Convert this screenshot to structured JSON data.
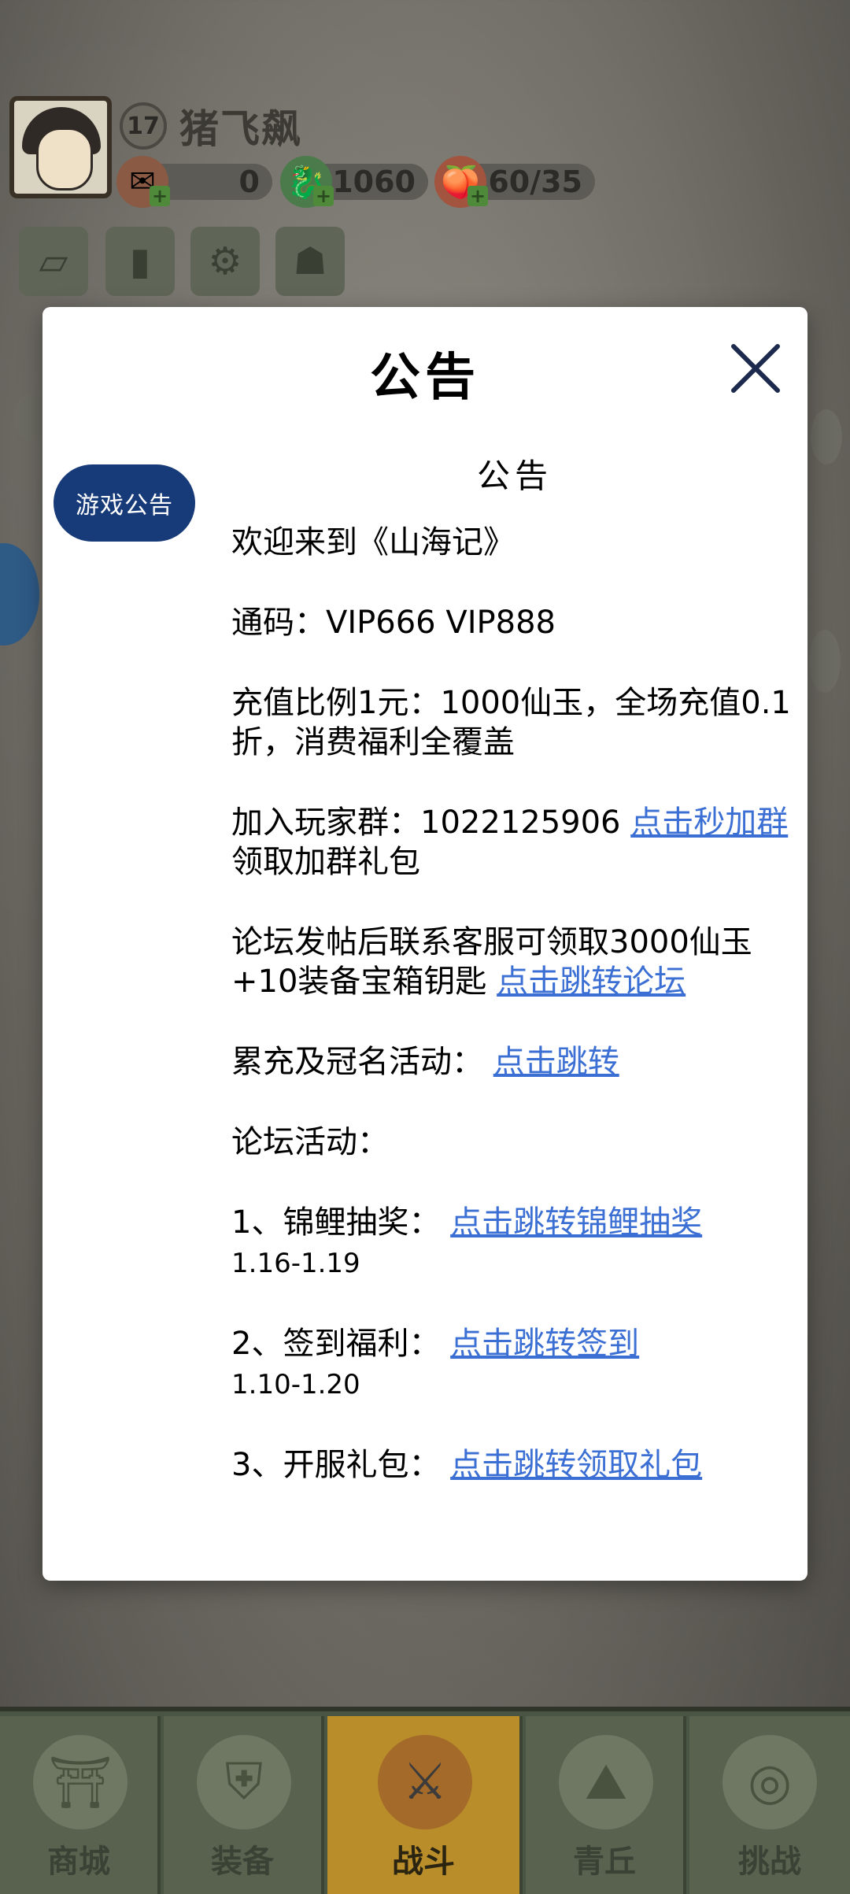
{
  "player": {
    "level": "17",
    "name": "猪飞飙",
    "resources": [
      {
        "icon": "red-packet-icon",
        "value": "0"
      },
      {
        "icon": "dragon-icon",
        "value": "1060"
      },
      {
        "icon": "peach-icon",
        "value": "160/35"
      }
    ]
  },
  "function_buttons": [
    "card-icon",
    "rank-chart-icon",
    "settings-gear-icon",
    "friends-icon"
  ],
  "modal": {
    "title": "公告",
    "tab_label": "游戏公告",
    "content": {
      "subtitle": "公告",
      "welcome": "欢迎来到《山海记》",
      "codes": "通码：VIP666 VIP888",
      "recharge": "充值比例1元：1000仙玉，全场充值0.1折，消费福利全覆盖",
      "group_prefix": "加入玩家群：1022125906 ",
      "group_link": "点击秒加群",
      "group_suffix": "领取加群礼包",
      "forum_prefix": "论坛发帖后联系客服可领取3000仙玉+10装备宝箱钥匙 ",
      "forum_link": "点击跳转论坛",
      "cumulative_prefix": "累充及冠名活动：  ",
      "cumulative_link": "点击跳转",
      "forum_activity": "论坛活动：",
      "item1_prefix": "1、锦鲤抽奖：  ",
      "item1_link": "点击跳转锦鲤抽奖",
      "item1_date": "1.16-1.19",
      "item2_prefix": "2、签到福利：  ",
      "item2_link": "点击跳转签到",
      "item2_date": "1.10-1.20",
      "item3_prefix": "3、开服礼包：  ",
      "item3_link": "点击跳转领取礼包"
    }
  },
  "bottom_nav": [
    {
      "label": "商城",
      "icon": "shop-icon",
      "active": false
    },
    {
      "label": "装备",
      "icon": "armor-icon",
      "active": false
    },
    {
      "label": "战斗",
      "icon": "crossed-swords-icon",
      "active": true
    },
    {
      "label": "青丘",
      "icon": "mountain-icon",
      "active": false
    },
    {
      "label": "挑战",
      "icon": "challenge-icon",
      "active": false
    }
  ],
  "colors": {
    "link": "#3b6fd4",
    "tab": "#173a78",
    "nav_active": "#b88d2a"
  }
}
